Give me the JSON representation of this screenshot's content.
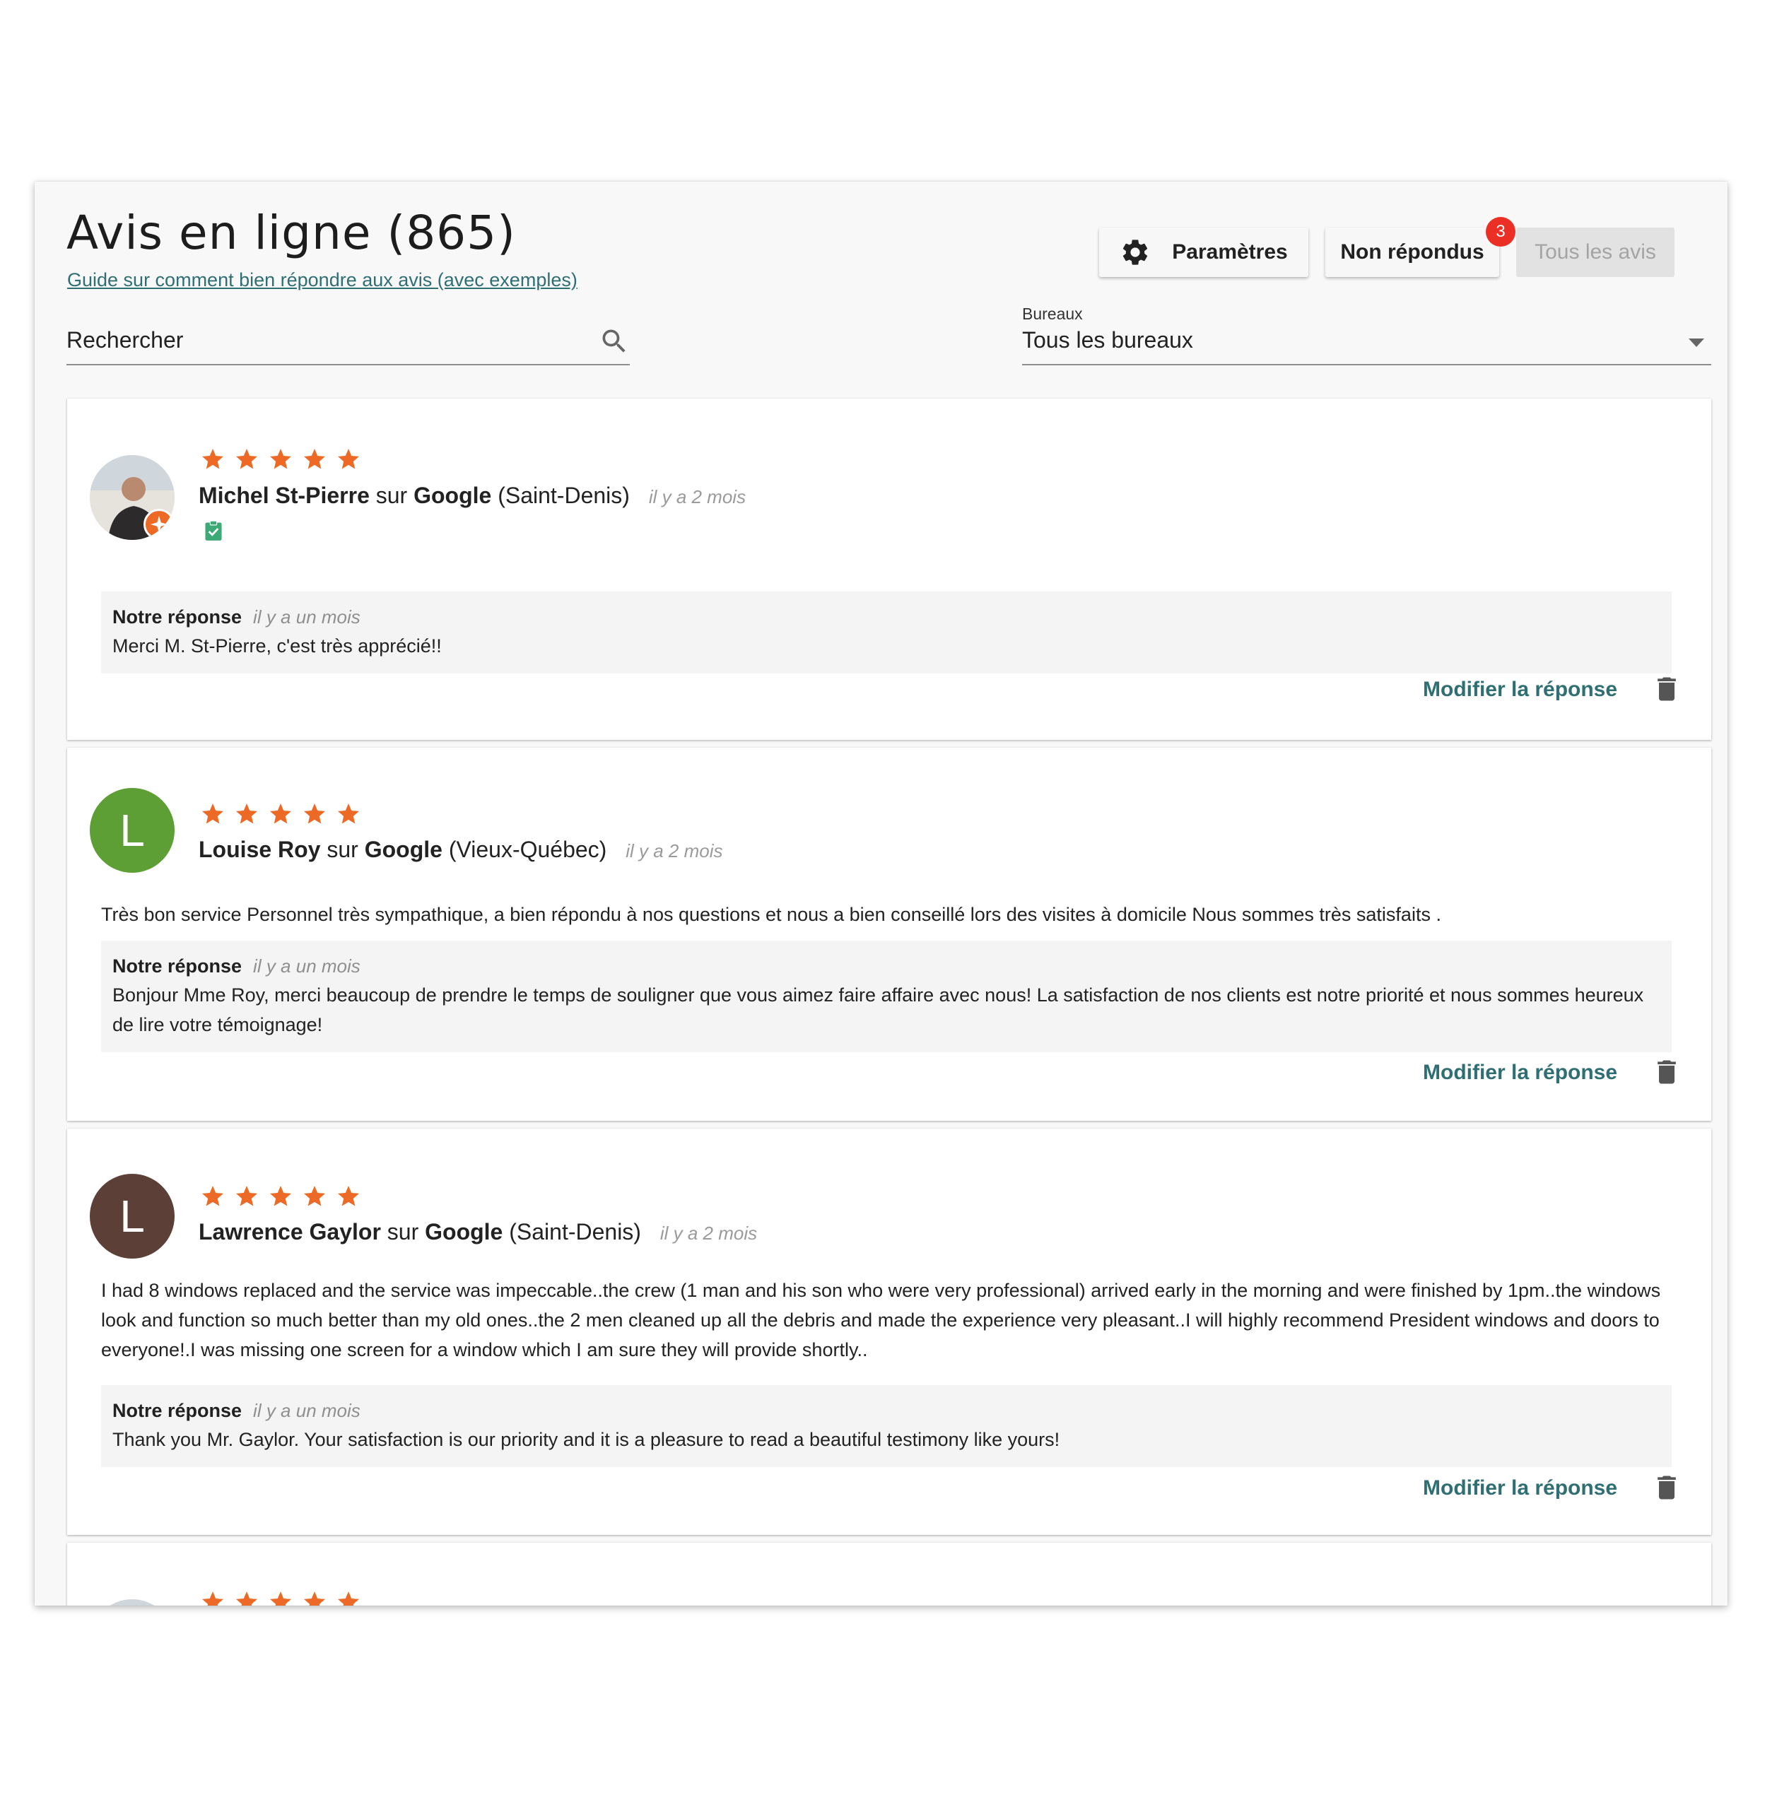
{
  "header": {
    "title": "Avis en ligne (865)",
    "guide_link": "Guide sur comment bien répondre aux avis (avec exemples)"
  },
  "toolbar": {
    "params_label": "Paramètres",
    "unanswered_label": "Non répondus",
    "unanswered_count": "3",
    "all_label": "Tous les avis"
  },
  "filters": {
    "search_placeholder": "Rechercher",
    "office_label": "Bureaux",
    "office_value": "Tous les bureaux"
  },
  "reviews": [
    {
      "name": "Michel St-Pierre",
      "platform_sep": "sur",
      "platform": "Google",
      "location": "(Saint-Denis)",
      "date": "il y a 2 mois",
      "rating": 5,
      "text": "",
      "avatar_type": "photo",
      "verified_icon": "verified-clipboard-icon",
      "reply_label": "Notre réponse",
      "reply_date": "il y a un mois",
      "reply_text": "Merci M. St-Pierre, c'est très apprécié!!",
      "edit_label": "Modifier la réponse"
    },
    {
      "name": "Louise Roy",
      "platform_sep": "sur",
      "platform": "Google",
      "location": "(Vieux-Québec)",
      "date": "il y a 2 mois",
      "rating": 5,
      "avatar_letter": "L",
      "avatar_color": "#5d9e35",
      "text": "Très bon service Personnel très sympathique, a bien répondu à nos questions et nous a bien conseillé lors des visites à domicile Nous sommes très satisfaits .",
      "reply_label": "Notre réponse",
      "reply_date": "il y a un mois",
      "reply_text": "Bonjour Mme Roy, merci beaucoup de prendre le temps de souligner que vous aimez faire affaire avec nous! La satisfaction de nos clients est notre priorité et nous sommes heureux de lire votre témoignage!",
      "edit_label": "Modifier la réponse"
    },
    {
      "name": "Lawrence Gaylor",
      "platform_sep": "sur",
      "platform": "Google",
      "location": "(Saint-Denis)",
      "date": "il y a 2 mois",
      "rating": 5,
      "avatar_letter": "L",
      "avatar_color": "#5c4037",
      "text": "I had 8 windows replaced and the service was impeccable..the crew (1 man and his son who were very professional) arrived early in the morning and were finished by 1pm..the windows look and function so much better than my old ones..the 2 men cleaned up all the debris and made the experience very pleasant..I will highly recommend President windows and doors to everyone!.I was missing one screen for a window which I am sure they will provide shortly..",
      "reply_label": "Notre réponse",
      "reply_date": "il y a un mois",
      "reply_text": "Thank you Mr. Gaylor. Your satisfaction is our priority and it is a pleasure to read a beautiful testimony like yours!",
      "edit_label": "Modifier la réponse"
    },
    {
      "rating": 5,
      "avatar_type": "photo"
    }
  ],
  "colors": {
    "accent": "#2f6f73",
    "star": "#ec6a26",
    "badge": "#ec2f24",
    "verified": "#3daa76"
  }
}
